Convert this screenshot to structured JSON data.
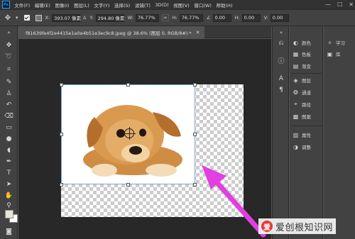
{
  "app": {
    "logo": "Ps"
  },
  "menu": [
    "文件(F)",
    "编辑(E)",
    "图像(I)",
    "图层(L)",
    "文字(Y)",
    "选择(S)",
    "滤镜(T)",
    "3D(D)",
    "视图(V)",
    "窗口(W)",
    "帮助(H)"
  ],
  "window_controls": {
    "minimize": "—",
    "maximize": "☐",
    "close": "✕"
  },
  "options": {
    "x_label": "X:",
    "x_value": "393.07 像素",
    "y_label": "Y:",
    "y_value": "294.80 像素",
    "w_label": "W:",
    "w_value": "76.77%",
    "h_label": "H:",
    "h_value": "76.77%",
    "angle_value": "0.00",
    "h_skew_label": "H:",
    "h_skew_value": "0.00",
    "v_skew_label": "V:",
    "v_skew_value": "0.00"
  },
  "document": {
    "tab_title": "f81639fe4f2e4415e1a0e4b51e3ec9c8.jpeg @ 38.6% (图层 0, RGB/8#) *",
    "close": "✕"
  },
  "panels": {
    "col1": [
      "颜色",
      "色板",
      "渐变",
      "图层",
      "通道",
      "路径",
      "图案",
      "属性",
      "调整"
    ],
    "col2": [
      "学习",
      "库"
    ]
  },
  "watermark": {
    "logo": "爱",
    "text": "爱创根知识网"
  },
  "colors": {
    "arrow": "#e23fe0",
    "accent": "#31a8ff",
    "foreground_swatch": "#e9e4d8",
    "background_swatch": "#ffffff"
  }
}
